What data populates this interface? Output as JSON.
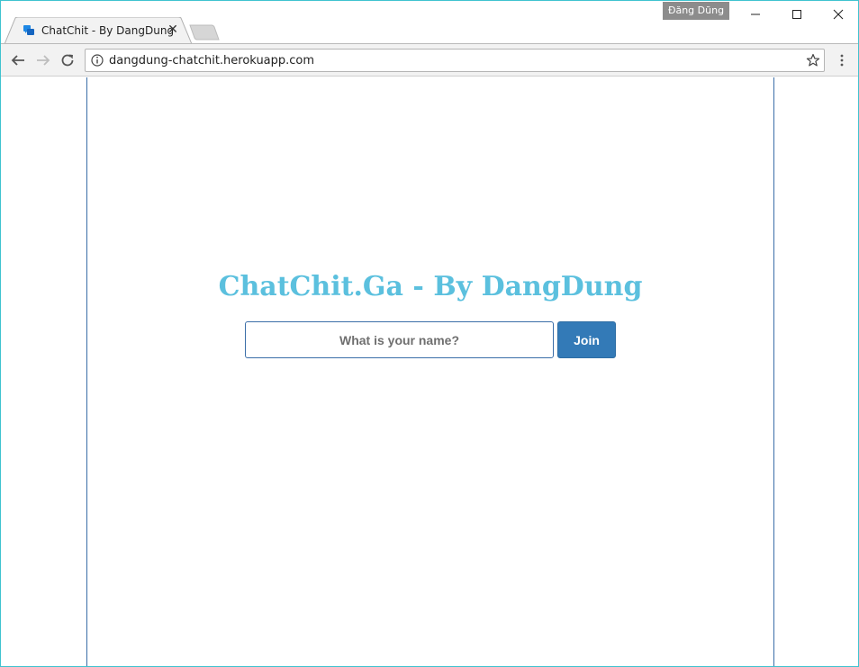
{
  "browser": {
    "tab": {
      "title": "ChatChit - By DangDung",
      "favicon": "chat-bubbles-icon",
      "close_icon": "close-icon"
    },
    "profile_name": "Đăng Dũng",
    "window_controls": [
      "minimize-icon",
      "maximize-icon",
      "close-icon"
    ],
    "toolbar": {
      "url": "dangdung-chatchit.herokuapp.com",
      "icons": [
        "back-icon",
        "forward-icon",
        "reload-icon",
        "info-icon",
        "star-icon",
        "menu-icon"
      ]
    }
  },
  "page": {
    "title": "ChatChit.Ga - By DangDung",
    "name_input": {
      "placeholder": "What is your name?",
      "value": ""
    },
    "join_label": "Join"
  },
  "colors": {
    "title": "#5bc0de",
    "button": "#337ab7",
    "border": "#3b6ea8",
    "window_frame": "#3fc3cf",
    "profile_badge": "#8c8c8c"
  }
}
